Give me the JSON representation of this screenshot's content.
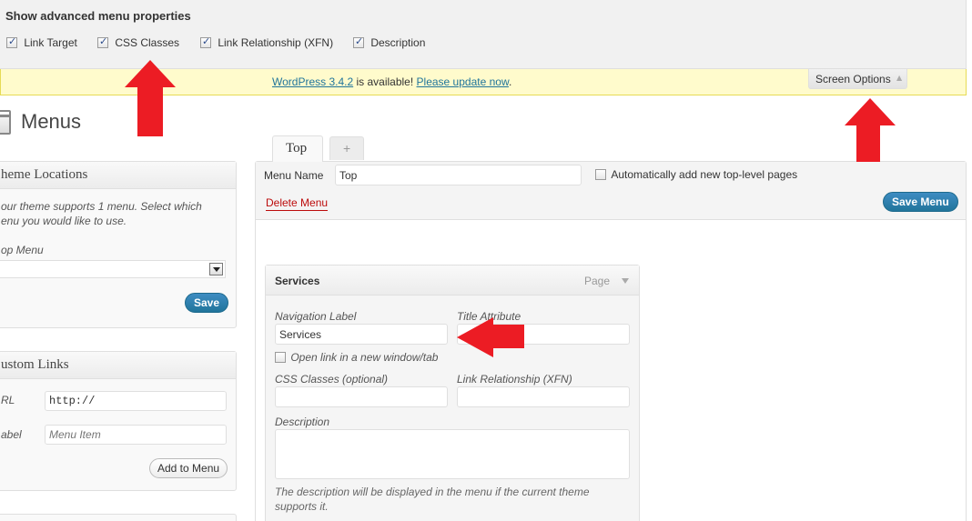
{
  "screen_options": {
    "title": "Show advanced menu properties",
    "options": [
      {
        "label": "Link Target",
        "checked": true
      },
      {
        "label": "CSS Classes",
        "checked": true
      },
      {
        "label": "Link Relationship (XFN)",
        "checked": true
      },
      {
        "label": "Description",
        "checked": true
      }
    ],
    "tab_label": "Screen Options",
    "tab_glyph": "▲"
  },
  "update_nag": {
    "version_link": "WordPress 3.4.2",
    "middle_text": " is available! ",
    "update_link": "Please update now",
    "end_text": "."
  },
  "page": {
    "title": "Menus"
  },
  "theme_locations": {
    "title": "heme Locations",
    "description_line1": "our theme supports 1 menu. Select which",
    "description_line2": "enu you would like to use.",
    "field_label": "op Menu",
    "selected": "",
    "save_label": "Save"
  },
  "custom_links": {
    "title": "ustom Links",
    "url_label": "RL",
    "url_value": "http://",
    "label_label": "abel",
    "label_placeholder": "Menu Item",
    "add_label": "Add to Menu"
  },
  "menu_tabs": [
    {
      "label": "Top",
      "active": true
    },
    {
      "label": "+",
      "active": false
    }
  ],
  "menu_header": {
    "name_label": "Menu Name",
    "name_value": "Top",
    "auto_add_label": "Automatically add new top-level pages",
    "auto_add_checked": false,
    "delete_label": "Delete Menu",
    "save_label": "Save Menu"
  },
  "menu_item": {
    "title": "Services",
    "type": "Page",
    "nav_label_label": "Navigation Label",
    "nav_label_value": "Services",
    "title_attr_label": "Title Attribute",
    "title_attr_value": "",
    "open_new_label": "Open link in a new window/tab",
    "open_new_checked": false,
    "css_label": "CSS Classes (optional)",
    "css_value": "",
    "xfn_label": "Link Relationship (XFN)",
    "xfn_value": "",
    "desc_label": "Description",
    "desc_value": "",
    "desc_help_line1": "The description will be displayed in the menu if the current theme",
    "desc_help_line2": "supports it."
  },
  "colors": {
    "annotation_arrow": "#ec1c24",
    "link": "#21759b",
    "nag_bg": "#fffbcc"
  }
}
